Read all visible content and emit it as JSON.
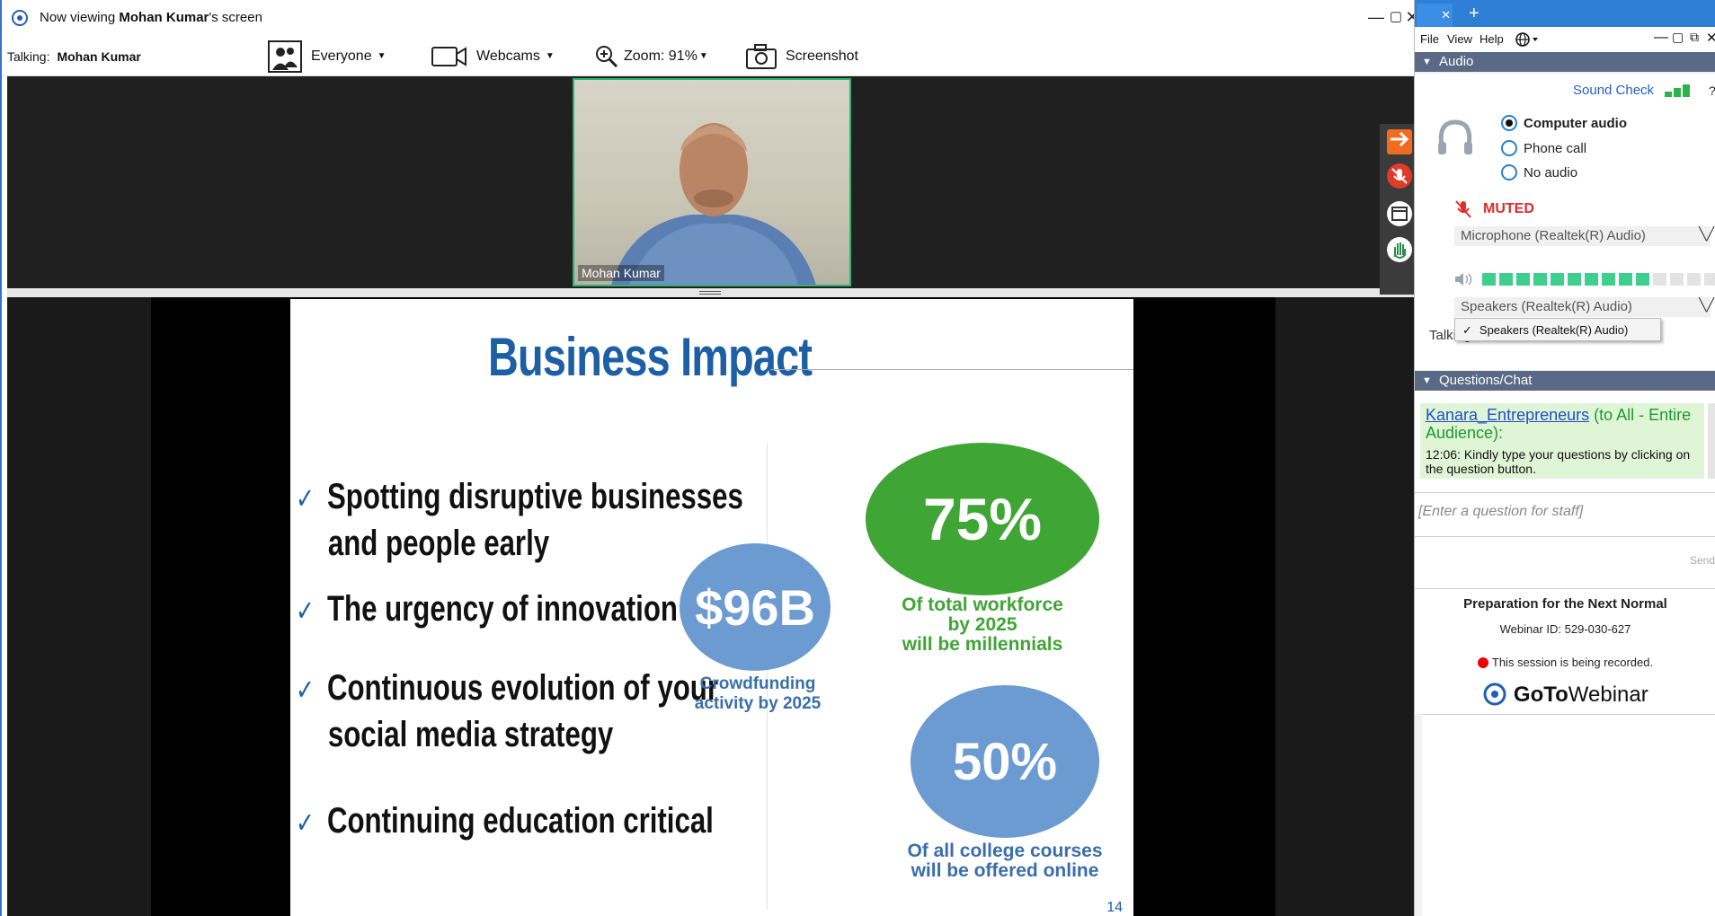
{
  "titlebar": {
    "prefix": "Now viewing ",
    "presenter": "Mohan Kumar",
    "suffix": "'s screen",
    "min": "—",
    "max": "▢",
    "close": "✕"
  },
  "toolbar": {
    "talking_label": "Talking:",
    "talking_name": "Mohan Kumar",
    "everyone": "Everyone",
    "webcams": "Webcams",
    "zoom": "Zoom: 91%",
    "screenshot": "Screenshot"
  },
  "webcam": {
    "name": "Mohan Kumar"
  },
  "slide": {
    "title": "Business Impact",
    "bullets": [
      {
        "line1": "Spotting disruptive businesses",
        "line2": "and people early"
      },
      {
        "line1": "The urgency of innovation",
        "line2": ""
      },
      {
        "line1": "Continuous evolution of your",
        "line2": "social media strategy"
      },
      {
        "line1": "Continuing education critical",
        "line2": ""
      }
    ],
    "stat1": {
      "value": "$96B",
      "caption1": "Crowdfunding",
      "caption2": "activity by 2025"
    },
    "stat2": {
      "value": "75%",
      "caption1": "Of total workforce",
      "caption2": "by 2025",
      "caption3": "will be millennials"
    },
    "stat3": {
      "value": "50%",
      "caption1": "Of all college courses",
      "caption2": "will be offered online"
    },
    "page": "14",
    "colors": {
      "blue": "#1d5fa5",
      "green": "#3fa535",
      "circle_blue": "#6b9bd1"
    }
  },
  "panel": {
    "tab_close": "✕",
    "tab_add": "+",
    "menu": [
      "File",
      "View",
      "Help"
    ],
    "audio": {
      "header": "Audio",
      "sound_check": "Sound Check",
      "help": "?",
      "options": [
        "Computer audio",
        "Phone call",
        "No audio"
      ],
      "selected": "Computer audio",
      "muted": "MUTED",
      "microphone": "Microphone (Realtek(R) Audio)",
      "speakers": "Speakers (Realtek(R) Audio)",
      "dropdown_item": "Speakers (Realtek(R) Audio)",
      "talking_partial": "Talking: Mohan Kumar",
      "meter_level": 0.7
    },
    "chat": {
      "header": "Questions/Chat",
      "sender": "Kanara_Entrepreneurs",
      "audience": " (to All - Entire Audience):",
      "message": "12:06: Kindly type your questions by clicking on the question button.",
      "placeholder": "[Enter a question for staff]",
      "send": "Send"
    },
    "info": {
      "webinar_title": "Preparation for the Next Normal",
      "webinar_id": "Webinar ID: 529-030-627",
      "recording": "This session is being recorded.",
      "brand_goto": "GoTo",
      "brand_webinar": "Webinar"
    }
  }
}
